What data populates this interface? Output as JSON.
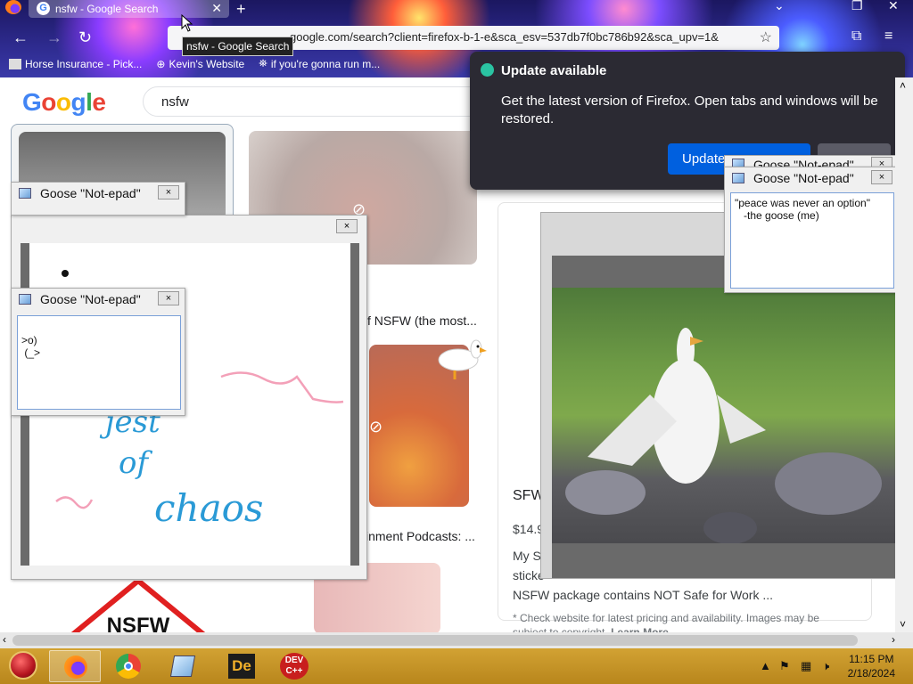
{
  "browser": {
    "tab_title": "nsfw - Google Search",
    "url": "google.com/search?client=firefox-b-1-e&sca_esv=537db7f0bc786b92&sca_upv=1&",
    "tooltip": "nsfw - Google Search",
    "bookmarks": [
      "Horse Insurance - Pick...",
      "Kevin's Website",
      "if you're gonna run m..."
    ]
  },
  "google": {
    "logo": "Google",
    "query": "nsfw",
    "captions": [
      "f NSFW (the most...",
      "inment Podcasts: ...",
      "SFW",
      "$14.9",
      "My S",
      "sticke"
    ],
    "snippet_line": "NSFW package contains NOT Safe for Work ...",
    "footnote": "* Check website for latest pricing and availability. Images may be",
    "footnote2": "subject to copyright.",
    "learn_more": "Learn More",
    "bottom_sign": "NSFW"
  },
  "notification": {
    "title": "Update available",
    "body": "Get the latest version of Firefox. Open tabs and windows will be restored.",
    "update_button": "Update now"
  },
  "notepads": {
    "title": "Goose \"Not-epad\"",
    "close": "×",
    "goose_ascii": ">o)\n (_>",
    "quote": "\"peace was never an option\"\n   -the goose (me)"
  },
  "drawing": {
    "words": [
      "jest",
      "of",
      "chaos"
    ]
  },
  "taskbar": {
    "time": "11:15 PM",
    "date": "2/18/2024",
    "apps": [
      "firefox",
      "chrome",
      "notepad",
      "dev-dot",
      "dev-cpp"
    ]
  },
  "colors": {
    "taskbar": "#c4962a",
    "update_button": "#0060df",
    "notification_bg": "#2b2a33"
  }
}
